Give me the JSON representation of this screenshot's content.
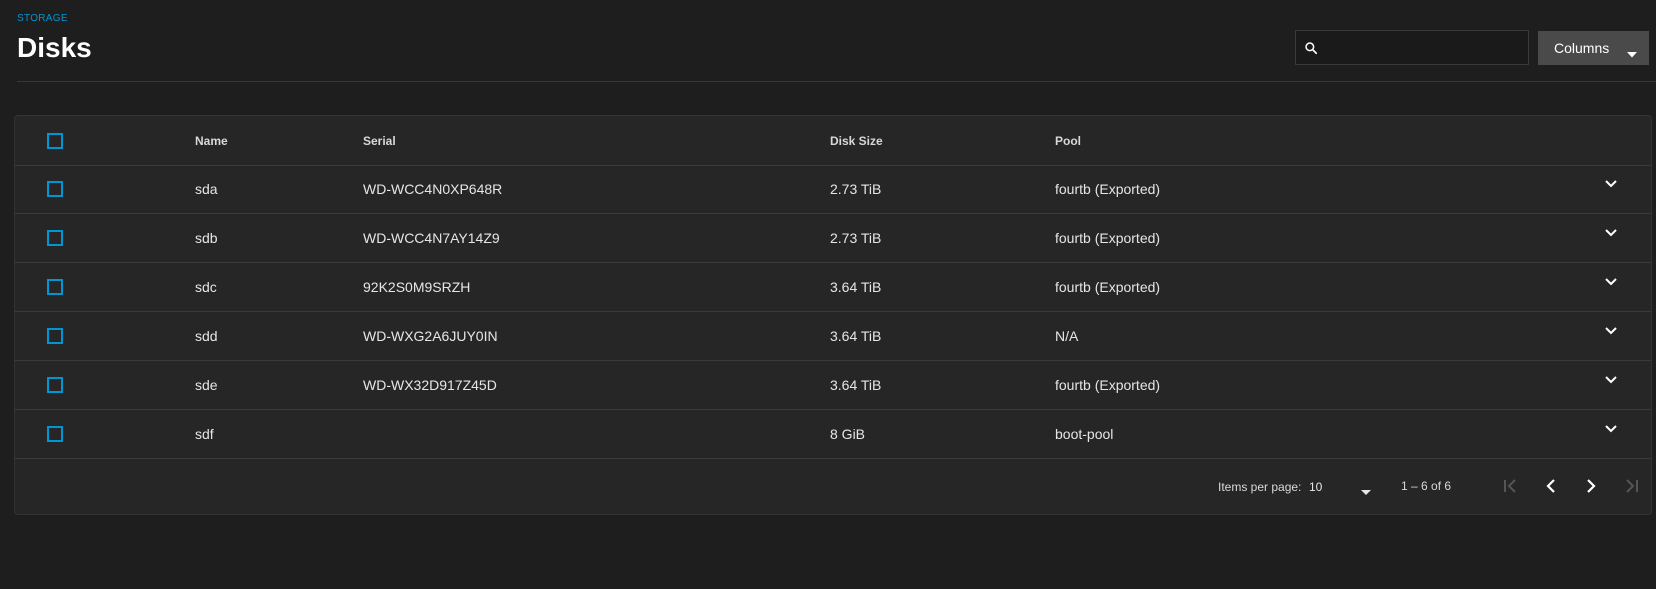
{
  "header": {
    "breadcrumb": "STORAGE",
    "title": "Disks"
  },
  "search": {
    "value": "",
    "placeholder": "",
    "icon": "search-icon"
  },
  "columns_button": {
    "label": "Columns",
    "icon": "caret-down-icon"
  },
  "table": {
    "headers": {
      "name": "Name",
      "serial": "Serial",
      "disk_size": "Disk Size",
      "pool": "Pool"
    },
    "rows": [
      {
        "name": "sda",
        "serial": "WD-WCC4N0XP648R",
        "disk_size": "2.73 TiB",
        "pool": "fourtb (Exported)"
      },
      {
        "name": "sdb",
        "serial": "WD-WCC4N7AY14Z9",
        "disk_size": "2.73 TiB",
        "pool": "fourtb (Exported)"
      },
      {
        "name": "sdc",
        "serial": "92K2S0M9SRZH",
        "disk_size": "3.64 TiB",
        "pool": "fourtb (Exported)"
      },
      {
        "name": "sdd",
        "serial": "WD-WXG2A6JUY0IN",
        "disk_size": "3.64 TiB",
        "pool": "N/A"
      },
      {
        "name": "sde",
        "serial": "WD-WX32D917Z45D",
        "disk_size": "3.64 TiB",
        "pool": "fourtb (Exported)"
      },
      {
        "name": "sdf",
        "serial": "",
        "disk_size": "8 GiB",
        "pool": "boot-pool"
      }
    ]
  },
  "paginator": {
    "items_per_page_label": "Items per page:",
    "items_per_page_value": "10",
    "range_label": "1 – 6 of 6"
  },
  "colors": {
    "accent": "#0095d5",
    "background": "#1e1e1e",
    "card": "#262626",
    "button": "#4a4a4a"
  }
}
